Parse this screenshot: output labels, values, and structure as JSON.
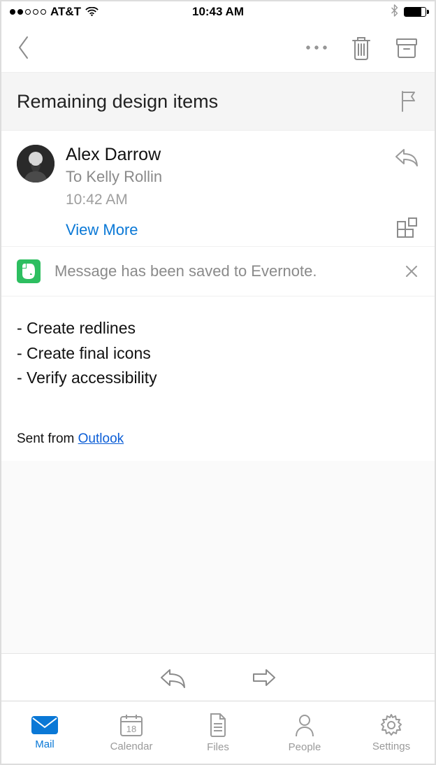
{
  "status_bar": {
    "carrier": "AT&T",
    "time": "10:43 AM"
  },
  "subject": "Remaining design items",
  "message": {
    "sender": "Alex Darrow",
    "recipient_line": "To Kelly Rollin",
    "time": "10:42 AM",
    "view_more_label": "View More",
    "banner_text": "Message has been saved to Evernote.",
    "body_lines": [
      "- Create redlines",
      "- Create final icons",
      "- Verify accessibility"
    ],
    "signature_prefix": "Sent from ",
    "signature_link": "Outlook"
  },
  "tabs": {
    "mail": "Mail",
    "calendar": "Calendar",
    "calendar_day": "18",
    "files": "Files",
    "people": "People",
    "settings": "Settings"
  }
}
